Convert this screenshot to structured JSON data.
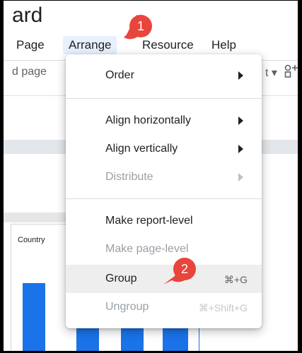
{
  "app": {
    "title_fragment": "ard"
  },
  "menubar": {
    "items": [
      "Page",
      "Arrange",
      "Resource",
      "Help"
    ],
    "active": "Arrange"
  },
  "toolbar": {
    "left_text": "d page",
    "right_text": "t ▾"
  },
  "canvas": {
    "table_header": "Country"
  },
  "arrange_menu": {
    "items": [
      {
        "label": "Order",
        "submenu": true,
        "disabled": false
      },
      {
        "label": "Align horizontally",
        "submenu": true,
        "disabled": false
      },
      {
        "label": "Align vertically",
        "submenu": true,
        "disabled": false
      },
      {
        "label": "Distribute",
        "submenu": true,
        "disabled": true
      },
      {
        "label": "Make report-level",
        "submenu": false,
        "disabled": false
      },
      {
        "label": "Make page-level",
        "submenu": false,
        "disabled": true
      },
      {
        "label": "Group",
        "shortcut": "⌘+G",
        "disabled": false,
        "highlighted": true
      },
      {
        "label": "Ungroup",
        "shortcut": "⌘+Shift+G",
        "disabled": true
      }
    ]
  },
  "annotations": {
    "badge1": "1",
    "badge2": "2",
    "color": "#e8453c"
  }
}
